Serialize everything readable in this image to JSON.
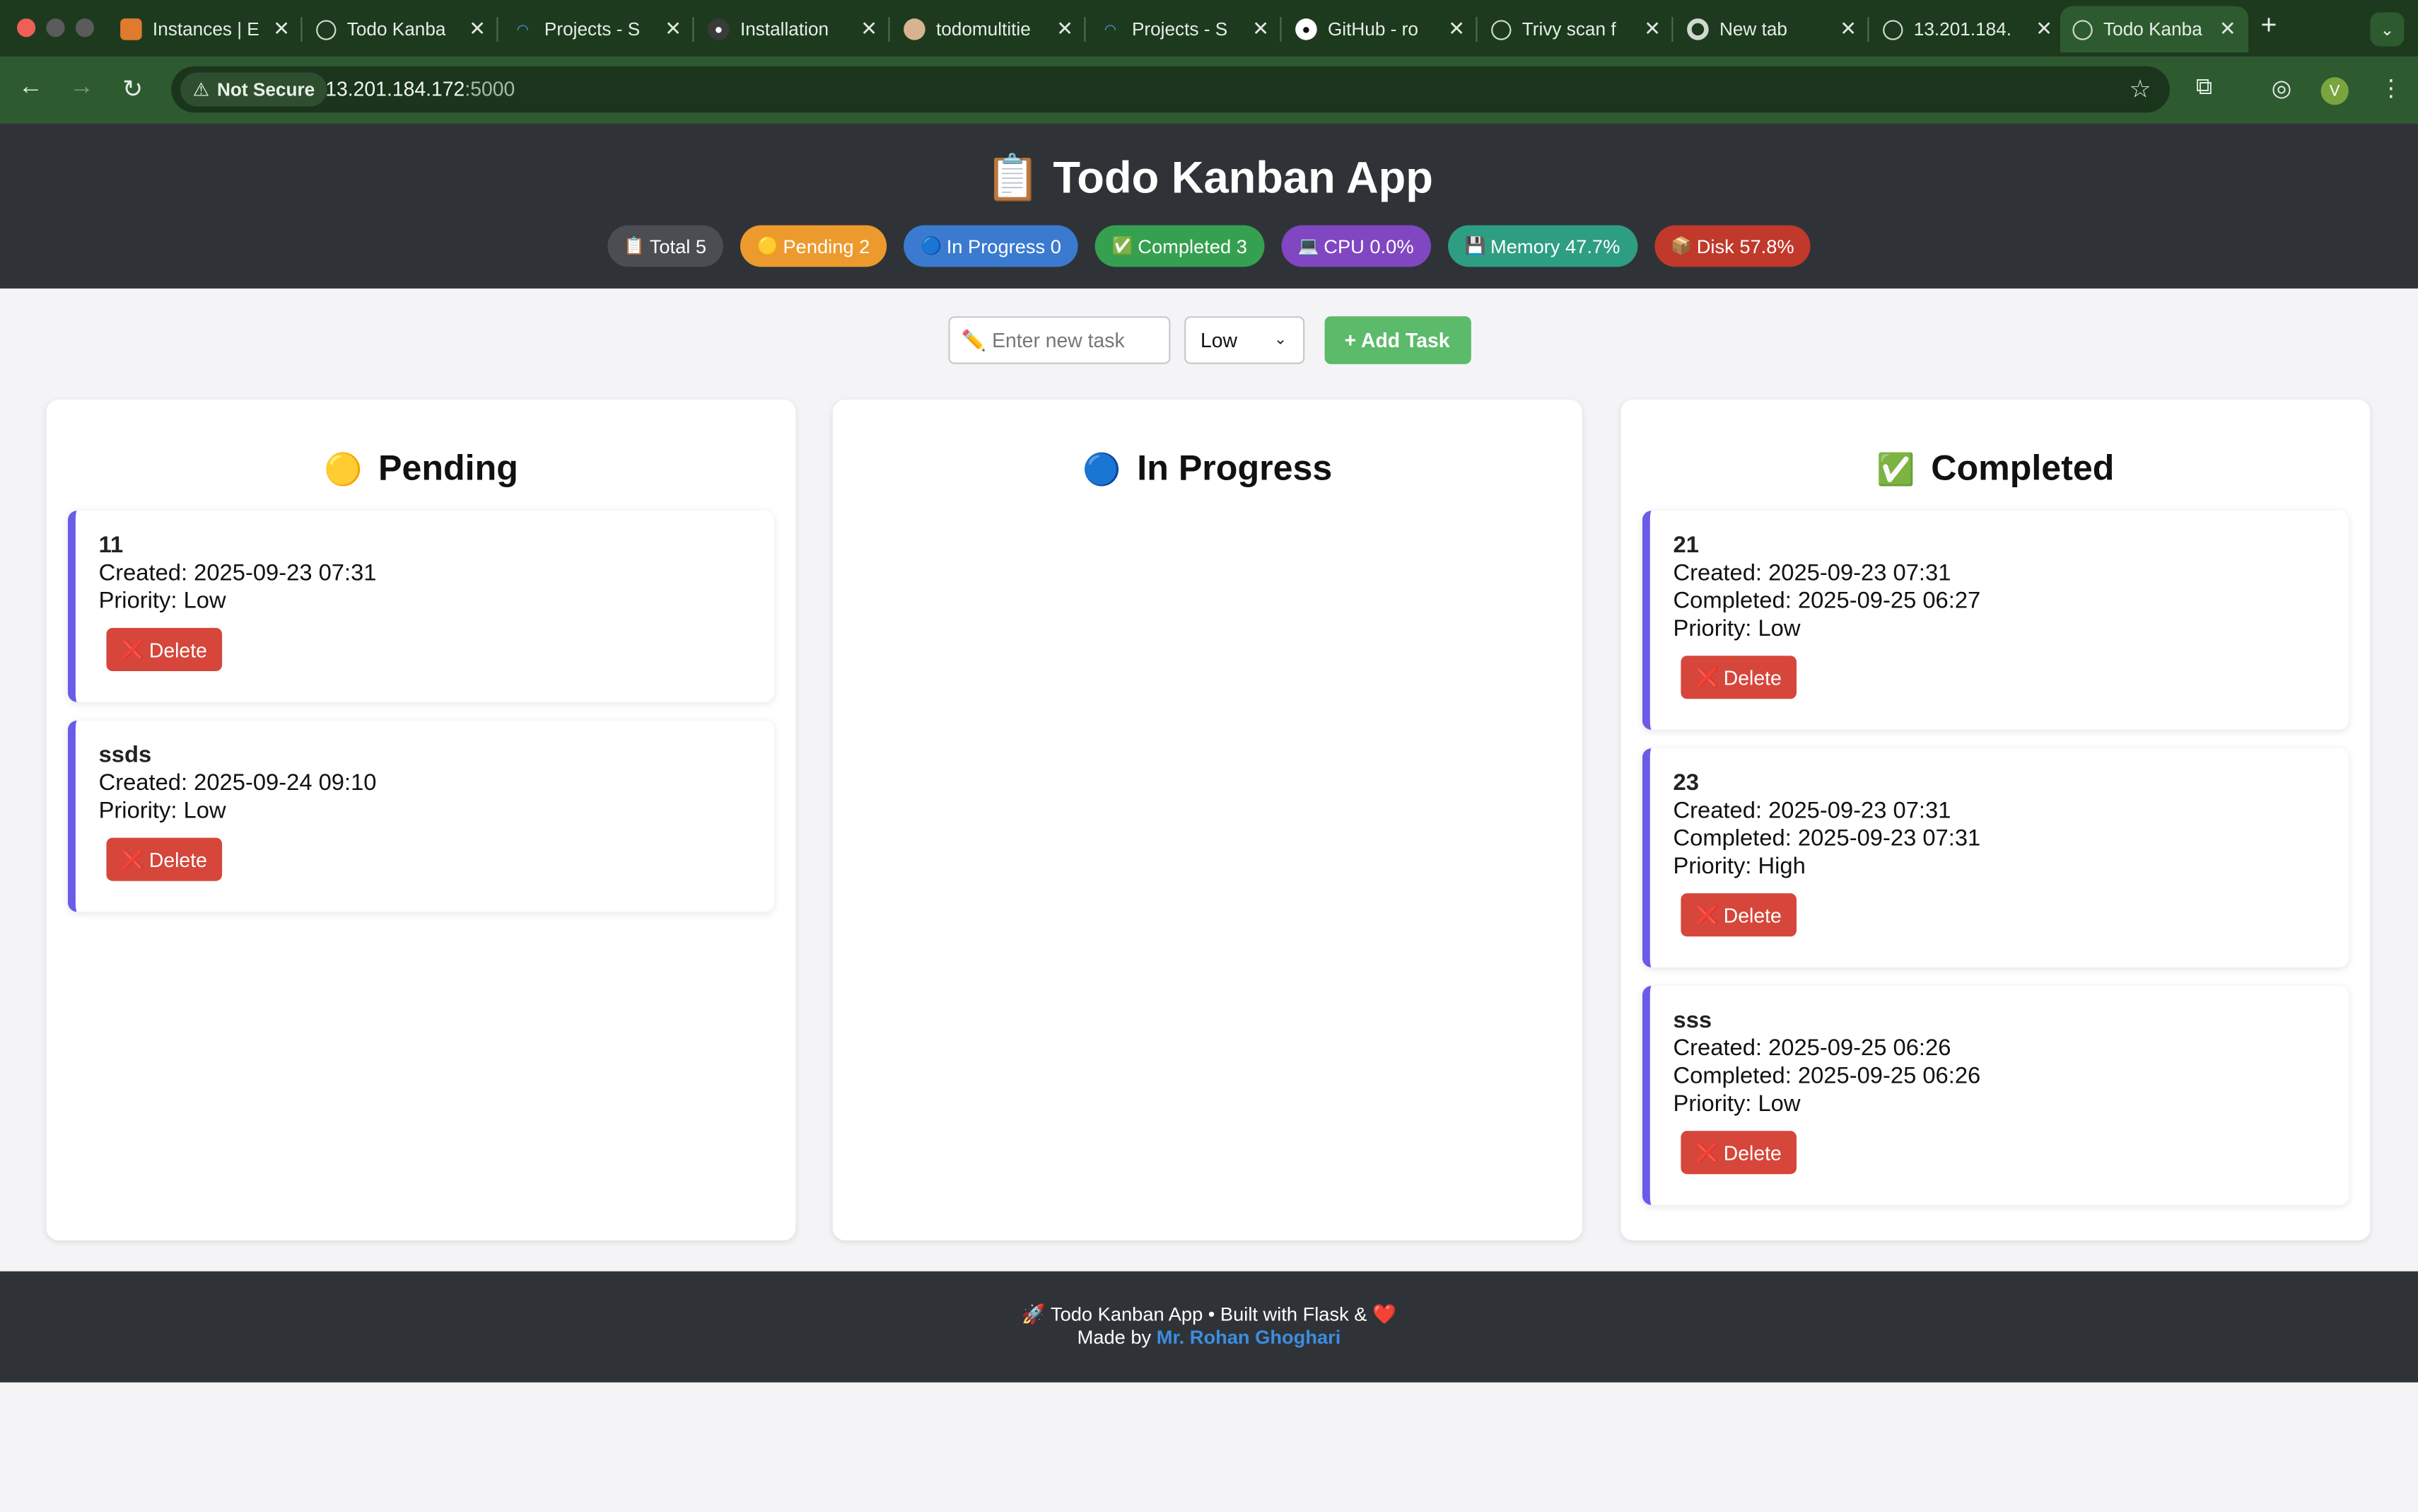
{
  "browser": {
    "tabs": [
      {
        "title": "Instances | E",
        "icon": "aws-icon"
      },
      {
        "title": "Todo Kanba",
        "icon": "globe-icon"
      },
      {
        "title": "Projects - S",
        "icon": "sonar-icon"
      },
      {
        "title": "Installation",
        "icon": "docs-icon"
      },
      {
        "title": "todomultitie",
        "icon": "jenkins-icon"
      },
      {
        "title": "Projects - S",
        "icon": "sonar-icon"
      },
      {
        "title": "GitHub - ro",
        "icon": "github-icon"
      },
      {
        "title": "Trivy scan f",
        "icon": "openai-icon"
      },
      {
        "title": "New tab",
        "icon": "chrome-icon"
      },
      {
        "title": "13.201.184.",
        "icon": "globe-icon"
      },
      {
        "title": "Todo Kanba",
        "icon": "globe-icon"
      }
    ],
    "active_tab_index": 10,
    "security_label": "Not Secure",
    "url_host": "13.201.184.172",
    "url_port": ":5000",
    "profile_initial": "V"
  },
  "app": {
    "title_icon": "📋",
    "title": "Todo Kanban App",
    "stats": [
      {
        "icon": "📋",
        "label": "Total 5",
        "color": "#4a4d52"
      },
      {
        "icon": "🟡",
        "label": "Pending 2",
        "color": "#ec9a2e"
      },
      {
        "icon": "🔵",
        "label": "In Progress 0",
        "color": "#3a7bd0"
      },
      {
        "icon": "✅",
        "label": "Completed 3",
        "color": "#35a050"
      },
      {
        "icon": "💻",
        "label": "CPU 0.0%",
        "color": "#8146c2"
      },
      {
        "icon": "💾",
        "label": "Memory 47.7%",
        "color": "#2e9e82"
      },
      {
        "icon": "📦",
        "label": "Disk 57.8%",
        "color": "#c0392b"
      }
    ],
    "form": {
      "input_placeholder": "✏️ Enter new task",
      "priority_selected": "Low",
      "add_label": "+ Add Task"
    },
    "columns": {
      "pending": {
        "icon": "🟡",
        "title": "Pending",
        "tasks": [
          {
            "title": "11",
            "created": "Created: 2025-09-23 07:31",
            "priority": "Priority: Low"
          },
          {
            "title": "ssds",
            "created": "Created: 2025-09-24 09:10",
            "priority": "Priority: Low"
          }
        ]
      },
      "in_progress": {
        "icon": "🔵",
        "title": "In Progress",
        "tasks": []
      },
      "completed": {
        "icon": "✅",
        "title": "Completed",
        "tasks": [
          {
            "title": "21",
            "created": "Created: 2025-09-23 07:31",
            "completed": "Completed: 2025-09-25 06:27",
            "priority": "Priority: Low"
          },
          {
            "title": "23",
            "created": "Created: 2025-09-23 07:31",
            "completed": "Completed: 2025-09-23 07:31",
            "priority": "Priority: High"
          },
          {
            "title": "sss",
            "created": "Created: 2025-09-25 06:26",
            "completed": "Completed: 2025-09-25 06:26",
            "priority": "Priority: Low"
          }
        ]
      }
    },
    "delete_label": "Delete",
    "delete_icon": "❌",
    "footer": {
      "line1": "🚀 Todo Kanban App • Built with Flask & ❤️",
      "made_by": "Made by",
      "author": "Mr. Rohan Ghoghari"
    }
  }
}
